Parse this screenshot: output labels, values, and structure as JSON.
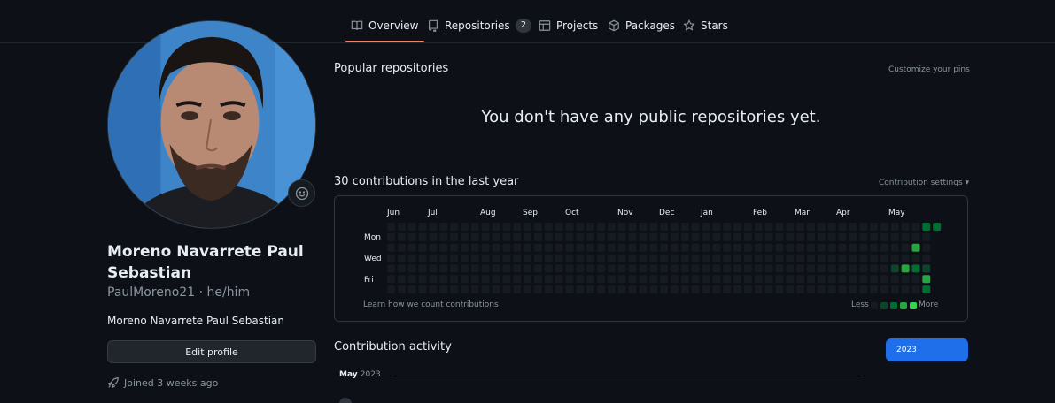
{
  "nav": {
    "tabs": [
      {
        "label": "Overview",
        "icon": "book-icon"
      },
      {
        "label": "Repositories",
        "icon": "repo-icon",
        "count": "2"
      },
      {
        "label": "Projects",
        "icon": "table-icon"
      },
      {
        "label": "Packages",
        "icon": "package-icon"
      },
      {
        "label": "Stars",
        "icon": "star-icon"
      }
    ],
    "active_tab": "Overview"
  },
  "profile": {
    "name": "Moreno Navarrete Paul Sebastian",
    "login": "PaulMoreno21",
    "pronouns": "he/him",
    "bio": "Moreno Navarrete Paul Sebastian",
    "edit_label": "Edit profile",
    "joined": "Joined 3 weeks ago",
    "status_icon": "smiley-icon"
  },
  "popular": {
    "title": "Popular repositories",
    "customize": "Customize your pins",
    "empty": "You don't have any public repositories yet."
  },
  "contributions": {
    "title": "30 contributions in the last year",
    "settings": "Contribution settings ▾",
    "months": [
      "Jun",
      "Jul",
      "Aug",
      "Sep",
      "Oct",
      "Nov",
      "Dec",
      "Jan",
      "Feb",
      "Mar",
      "Apr",
      "May"
    ],
    "days": [
      "Mon",
      "Wed",
      "Fri"
    ],
    "learn": "Learn how we count contributions",
    "less": "Less",
    "more": "More",
    "active_cells": [
      {
        "week": 51,
        "day": 0,
        "level": 2
      },
      {
        "week": 52,
        "day": 0,
        "level": 2
      },
      {
        "week": 50,
        "day": 2,
        "level": 3
      },
      {
        "week": 48,
        "day": 4,
        "level": 1
      },
      {
        "week": 49,
        "day": 4,
        "level": 3
      },
      {
        "week": 50,
        "day": 4,
        "level": 2
      },
      {
        "week": 51,
        "day": 4,
        "level": 1
      },
      {
        "week": 51,
        "day": 5,
        "level": 3
      },
      {
        "week": 51,
        "day": 6,
        "level": 2
      }
    ],
    "colors": [
      "#161b22",
      "#0e4429",
      "#006d32",
      "#26a641",
      "#39d353"
    ]
  },
  "activity": {
    "title": "Contribution activity",
    "year": "2023",
    "month": "May",
    "month_year": "2023"
  },
  "colors": {
    "background": "#0d1117",
    "accent": "#f78166",
    "button_blue": "#1f6feb"
  }
}
